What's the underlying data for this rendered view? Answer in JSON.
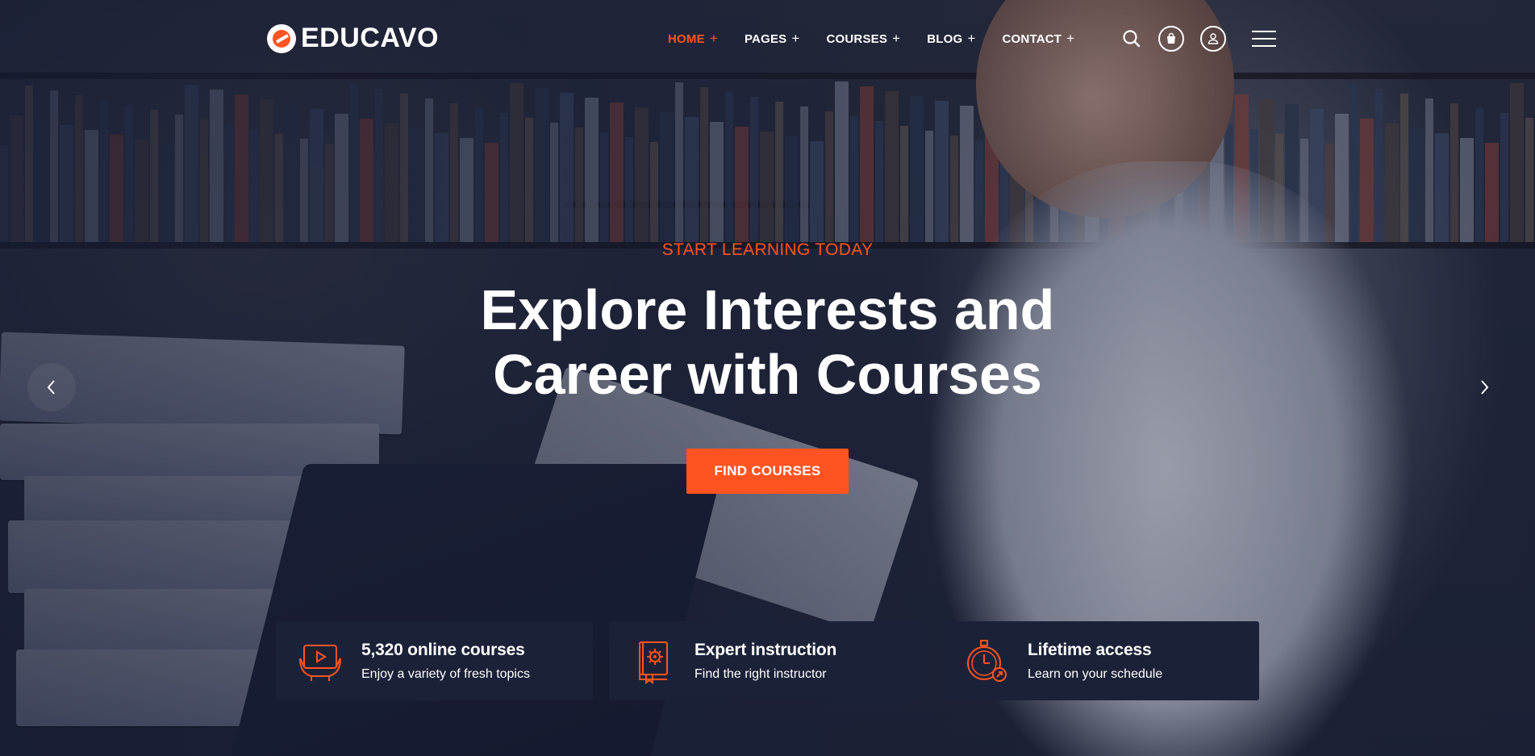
{
  "brand": {
    "name": "EDUCAVO",
    "accent_color": "#ff5421",
    "card_color": "#1b2238"
  },
  "nav": {
    "items": [
      {
        "label": "HOME",
        "active": true
      },
      {
        "label": "PAGES",
        "active": false
      },
      {
        "label": "COURSES",
        "active": false
      },
      {
        "label": "BLOG",
        "active": false
      },
      {
        "label": "CONTACT",
        "active": false
      }
    ],
    "expand_glyph": "+",
    "icons": [
      "search-icon",
      "cart-icon",
      "user-icon",
      "menu-icon"
    ]
  },
  "hero": {
    "eyebrow": "START LEARNING TODAY",
    "headline_line1": "Explore Interests and",
    "headline_line2": "Career with Courses",
    "cta_label": "FIND COURSES",
    "prev_icon": "chevron-left-icon",
    "next_icon": "chevron-right-icon"
  },
  "features": [
    {
      "title": "5,320 online courses",
      "subtitle": "Enjoy a variety of fresh topics",
      "icon": "video-lesson-icon"
    },
    {
      "title": "Expert instruction",
      "subtitle": "Find the right instructor",
      "icon": "book-gear-icon"
    },
    {
      "title": "Lifetime access",
      "subtitle": "Learn on your schedule",
      "icon": "stopwatch-icon"
    }
  ]
}
